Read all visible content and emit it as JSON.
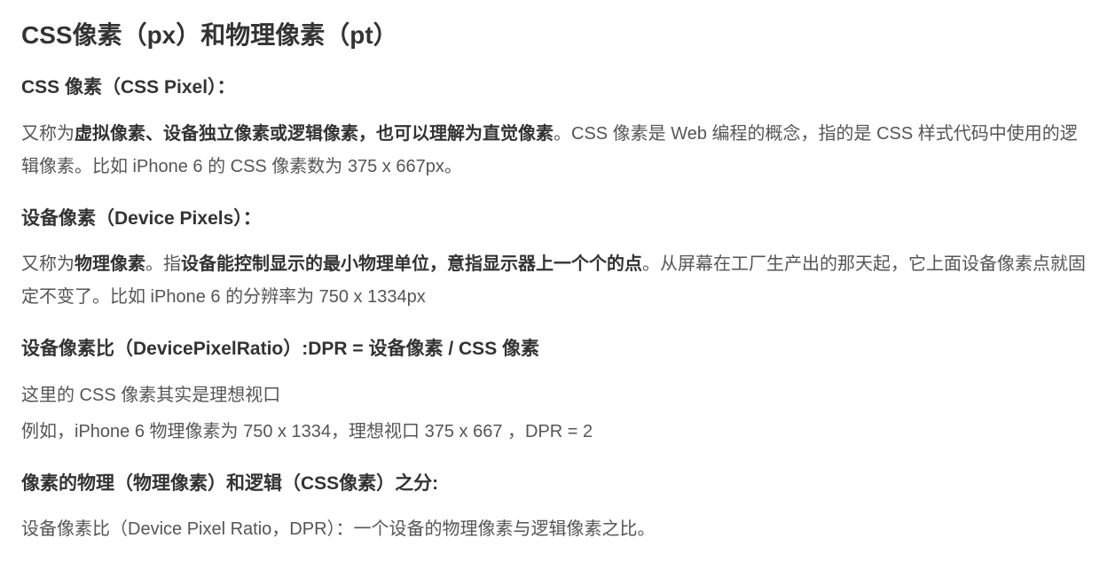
{
  "heading_main": "CSS像素（px）和物理像素（pt）",
  "section_css_pixel": {
    "heading": "CSS 像素（CSS Pixel）：",
    "p1_prefix": "又称为",
    "p1_bold": "虚拟像素、设备独立像素或逻辑像素，也可以理解为直觉像素",
    "p1_suffix": "。CSS 像素是 Web 编程的概念，指的是 CSS 样式代码中使用的逻辑像素。比如 iPhone 6 的 CSS 像素数为 375 x 667px。"
  },
  "section_device_pixels": {
    "heading": "设备像素（Device Pixels）：",
    "p1_prefix": "又称为",
    "p1_bold1": "物理像素",
    "p1_mid": "。指",
    "p1_bold2": "设备能控制显示的最小物理单位，意指显示器上一个个的点",
    "p1_suffix": "。从屏幕在工厂生产出的那天起，它上面设备像素点就固定不变了。比如 iPhone 6 的分辨率为 750 x 1334px"
  },
  "section_dpr": {
    "heading": "设备像素比（DevicePixelRatio）:DPR = 设备像素 / CSS 像素",
    "p1": "这里的 CSS 像素其实是理想视口",
    "p2": "例如，iPhone 6 物理像素为 750 x 1334，理想视口 375 x 667 ，DPR = 2"
  },
  "section_distinction": {
    "heading": "像素的物理（物理像素）和逻辑（CSS像素）之分:",
    "p1": "设备像素比（Device Pixel Ratio，DPR）：一个设备的物理像素与逻辑像素之比。"
  }
}
